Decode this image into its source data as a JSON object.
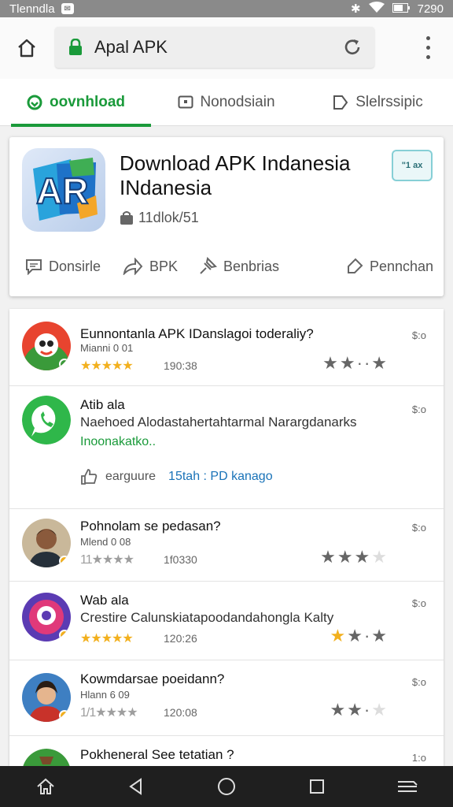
{
  "status_bar": {
    "carrier": "Tlenndla",
    "time": "7290"
  },
  "browser": {
    "url": "Apal APK"
  },
  "tabs": [
    {
      "label": "oovnhload",
      "active": true
    },
    {
      "label": "Nonodsiain",
      "active": false
    },
    {
      "label": "Slelrssipic",
      "active": false
    }
  ],
  "hero": {
    "title": "Download APK Indanesia INdanesia",
    "meta": "11dlok/51",
    "badge": "\"1 ax",
    "actions": [
      {
        "label": "Donsirle",
        "icon": "comment-icon"
      },
      {
        "label": "BPK",
        "icon": "share-icon"
      },
      {
        "label": "Benbrias",
        "icon": "pin-icon"
      },
      {
        "label": "Pennchan",
        "icon": "tag-icon"
      }
    ]
  },
  "apps": [
    {
      "title": "Eunnontanla APK IDanslagoi toderaliy?",
      "sub": "Mianni 0 01",
      "stars": "★★★★★",
      "time": "190:38",
      "right": "$:o"
    },
    {
      "title": "Atib ala",
      "desc": "Naehoed Alodastahertahtarmal Narargdanarks",
      "link": "Inoonakatko..",
      "footer_left": "earguure",
      "footer_right": "15tah : PD kanago",
      "right": "$:o"
    },
    {
      "title": "Pohnolam se pedasan?",
      "sub": "Mlend 0 08",
      "stars": "11★★★★",
      "time": "1f0330",
      "right": "$:o"
    },
    {
      "title": "Wab ala",
      "desc": "Crestire Calunskiatapoodandahongla Kalty",
      "stars": "★★★★★",
      "time": "120:26",
      "right": "$:o"
    },
    {
      "title": "Kowmdarsae poeidann?",
      "sub": "Hlann 6 09",
      "stars": "1/1★★★★",
      "time": "120:08",
      "right": "$:o"
    },
    {
      "title": "Pokheneral See tetatian ?",
      "right": "1:o"
    }
  ],
  "colors": {
    "accent": "#1a9a3a",
    "star": "#f2b01e",
    "navbar": "#1f1f1f"
  }
}
